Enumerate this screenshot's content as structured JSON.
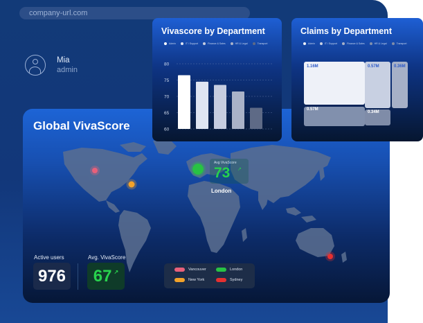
{
  "browser": {
    "url": "company-url.com"
  },
  "user": {
    "name": "Mia",
    "role": "admin"
  },
  "main": {
    "title": "Global VivaScore",
    "active_users": {
      "label": "Active users",
      "value": "976"
    },
    "avg_score": {
      "label": "Avg. VivaScore",
      "value": "67",
      "arrow": "↗"
    },
    "callout": {
      "label": "Avg VivaScore",
      "value": "73",
      "arrow": "↗",
      "city": "London"
    },
    "legend": [
      {
        "name": "Vancouver",
        "color": "#e8607a"
      },
      {
        "name": "London",
        "color": "#28c244"
      },
      {
        "name": "New York",
        "color": "#f2a22a"
      },
      {
        "name": "Sydney",
        "color": "#e53030"
      }
    ],
    "markers": [
      {
        "city": "Vancouver",
        "color": "#e8607a"
      },
      {
        "city": "New York",
        "color": "#f2a22a"
      },
      {
        "city": "London",
        "color": "#28c244"
      },
      {
        "city": "Sydney",
        "color": "#e53030"
      }
    ]
  },
  "chart_data": [
    {
      "type": "bar",
      "title": "Vivascore by Department",
      "categories": [
        "Admin",
        "IT / Support",
        "Finance & Sales",
        "HR & Legal",
        "Transport"
      ],
      "values": [
        76.5,
        74.5,
        73.5,
        71.5,
        66.5
      ],
      "yticks": [
        60,
        65,
        70,
        75,
        80
      ],
      "ylim": [
        60,
        80
      ],
      "grid": true,
      "legend": "top",
      "colors": [
        "#ffffff",
        "#dfe5f2",
        "#c6cde0",
        "#a9b2c8",
        "#5e6a86"
      ]
    },
    {
      "type": "treemap",
      "title": "Claims by Department",
      "categories": [
        "Admin",
        "IT / Support",
        "Finance & Sales",
        "HR & Legal",
        "Transport"
      ],
      "values": [
        1.16,
        0.57,
        0.36,
        0.57,
        0.34
      ],
      "value_labels": [
        "1.16M",
        "0.57M",
        "0.36M",
        "0.57M",
        "0.34M"
      ],
      "legend": "top",
      "colors": [
        "#eef1f8",
        "#c8d0e2",
        "#a6b0c7",
        "#8190ad",
        "#7f8ca8"
      ]
    }
  ],
  "colors": {
    "accent_green": "#28d24d",
    "panel_blue": "#1d64d6"
  }
}
